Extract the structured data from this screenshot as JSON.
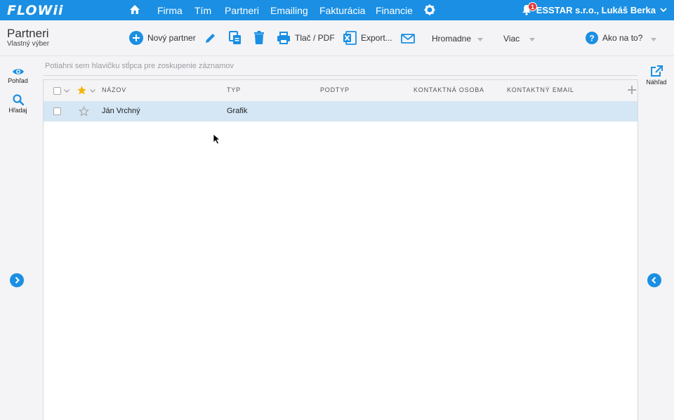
{
  "app": {
    "logo": "FLOWii",
    "account": "ESSTAR s.r.o., Lukáš Berka",
    "notifications": "1"
  },
  "nav": {
    "items": [
      "Firma",
      "Tím",
      "Partneri",
      "Emailing",
      "Fakturácia",
      "Financie"
    ]
  },
  "page": {
    "title": "Partneri",
    "subtitle": "Vlastný výber"
  },
  "toolbar": {
    "new_partner": "Nový partner",
    "print_pdf": "Tlač / PDF",
    "export": "Export...",
    "bulk": "Hromadne",
    "more": "Viac",
    "help": "Ako na to?"
  },
  "leftrail": {
    "view": "Pohľad",
    "search": "Hľadaj"
  },
  "rightrail": {
    "preview": "Náhľad"
  },
  "grid": {
    "group_placeholder": "Potiahni sem hlavičku stĺpca pre zoskupenie záznamov",
    "columns": [
      "NÁZOV",
      "TYP",
      "PODTYP",
      "KONTAKTNÁ OSOBA",
      "KONTAKTNÝ EMAIL"
    ],
    "rows": [
      {
        "name": "Ján Vrchný",
        "type": "Grafik",
        "subtype": "",
        "contact": "",
        "email": ""
      }
    ]
  },
  "colors": {
    "brand": "#1a8fe3",
    "selected_row": "#d5e6f4",
    "badge": "#e53935",
    "star": "#f4b400"
  }
}
